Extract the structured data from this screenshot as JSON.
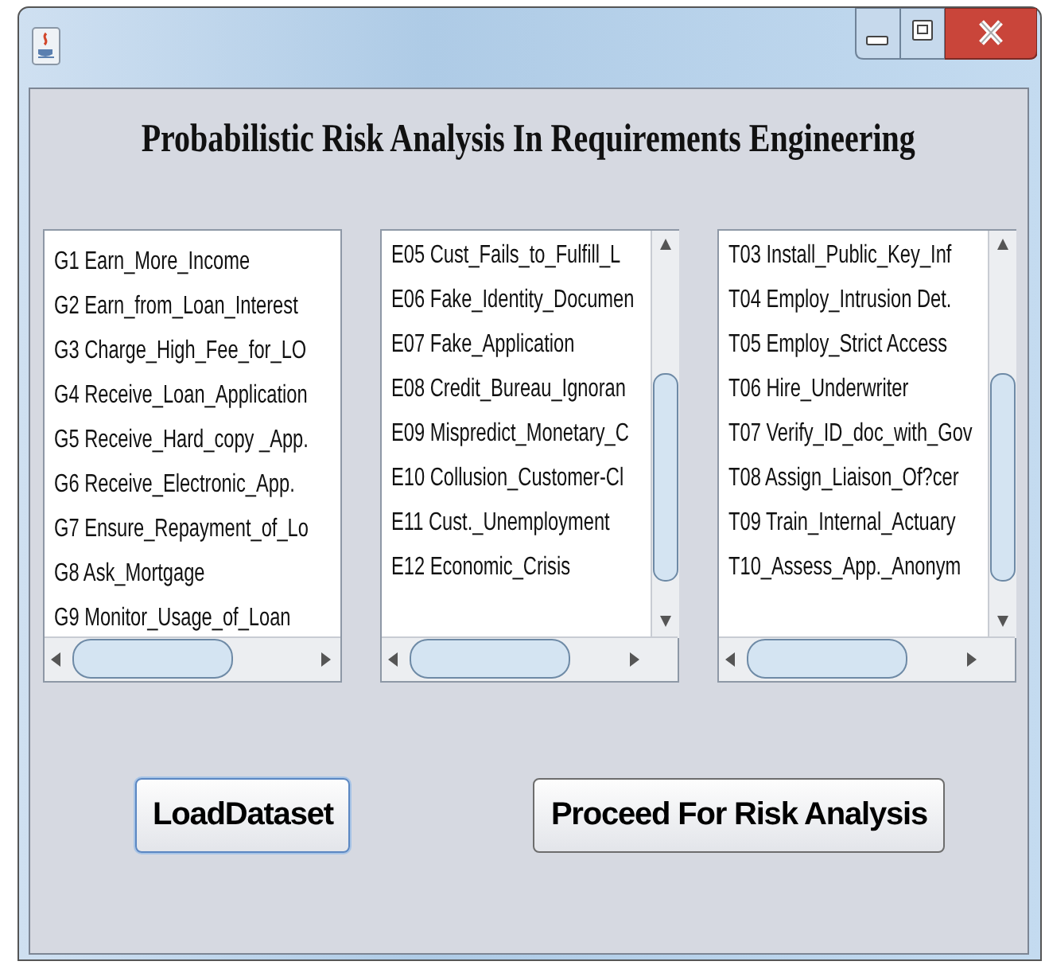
{
  "window": {
    "heading": "Probabilistic Risk Analysis In Requirements Engineering"
  },
  "lists": [
    {
      "vertical_scrollbar": false,
      "items": [
        "G1 Earn_More_Income",
        "G2 Earn_from_Loan_Interest",
        "G3 Charge_High_Fee_for_LO",
        "G4 Receive_Loan_Application",
        "G5 Receive_Hard_copy _App.",
        "G6 Receive_Electronic_App.",
        "G7 Ensure_Repayment_of_Lo",
        "G8 Ask_Mortgage",
        "G9 Monitor_Usage_of_Loan"
      ]
    },
    {
      "vertical_scrollbar": true,
      "items": [
        "E05 Cust_Fails_to_Fulfill_L",
        "E06 Fake_Identity_Documen",
        "E07 Fake_Application",
        "E08 Credit_Bureau_Ignoran",
        "E09 Mispredict_Monetary_C",
        "E10 Collusion_Customer-Cl",
        "E11 Cust._Unemployment",
        "E12 Economic_Crisis"
      ]
    },
    {
      "vertical_scrollbar": true,
      "items": [
        "T03 Install_Public_Key_Inf",
        "T04 Employ_Intrusion Det.",
        "T05 Employ_Strict Access",
        "T06 Hire_Underwriter",
        "T07 Verify_ID_doc_with_Gov",
        "T08 Assign_Liaison_Of?cer",
        "T09 Train_Internal_Actuary",
        "T10_Assess_App._Anonym"
      ]
    }
  ],
  "buttons": [
    {
      "label": "LoadDataset",
      "focused": true
    },
    {
      "label": "Proceed For Risk Analysis",
      "focused": false
    }
  ]
}
